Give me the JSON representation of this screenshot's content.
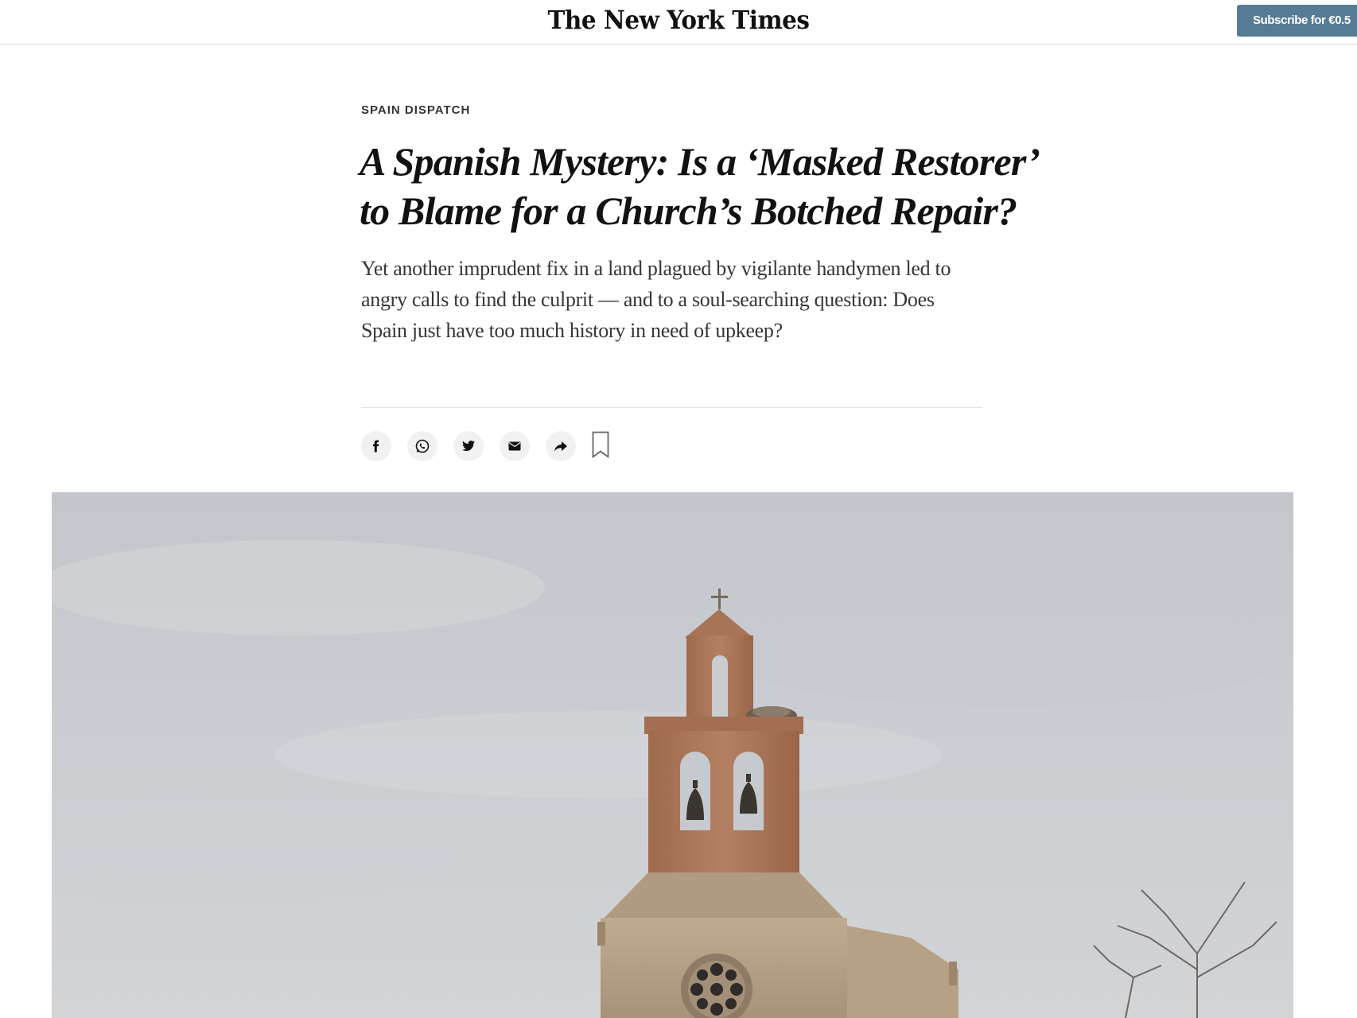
{
  "header": {
    "masthead": "The New York Times",
    "subscribe_label": "Subscribe for €0.5"
  },
  "article": {
    "kicker": "SPAIN DISPATCH",
    "headline": "A Spanish Mystery: Is a ‘Masked Restorer’ to Blame for a Church’s Botched Repair?",
    "summary": "Yet another imprudent fix in a land plagued by vigilante handymen led to angry calls to find the culprit — and to a soul-searching question: Does Spain just have too much history in need of upkeep?"
  },
  "share_bar": {
    "icons": [
      "facebook-icon",
      "whatsapp-icon",
      "twitter-icon",
      "email-icon",
      "share-icon",
      "bookmark-icon"
    ]
  },
  "hero_image": {
    "subject": "stone-church-with-bell-tower",
    "colors": {
      "sky": "#c9ccd0",
      "stone": "#b59f84",
      "brick": "#a97556"
    }
  }
}
